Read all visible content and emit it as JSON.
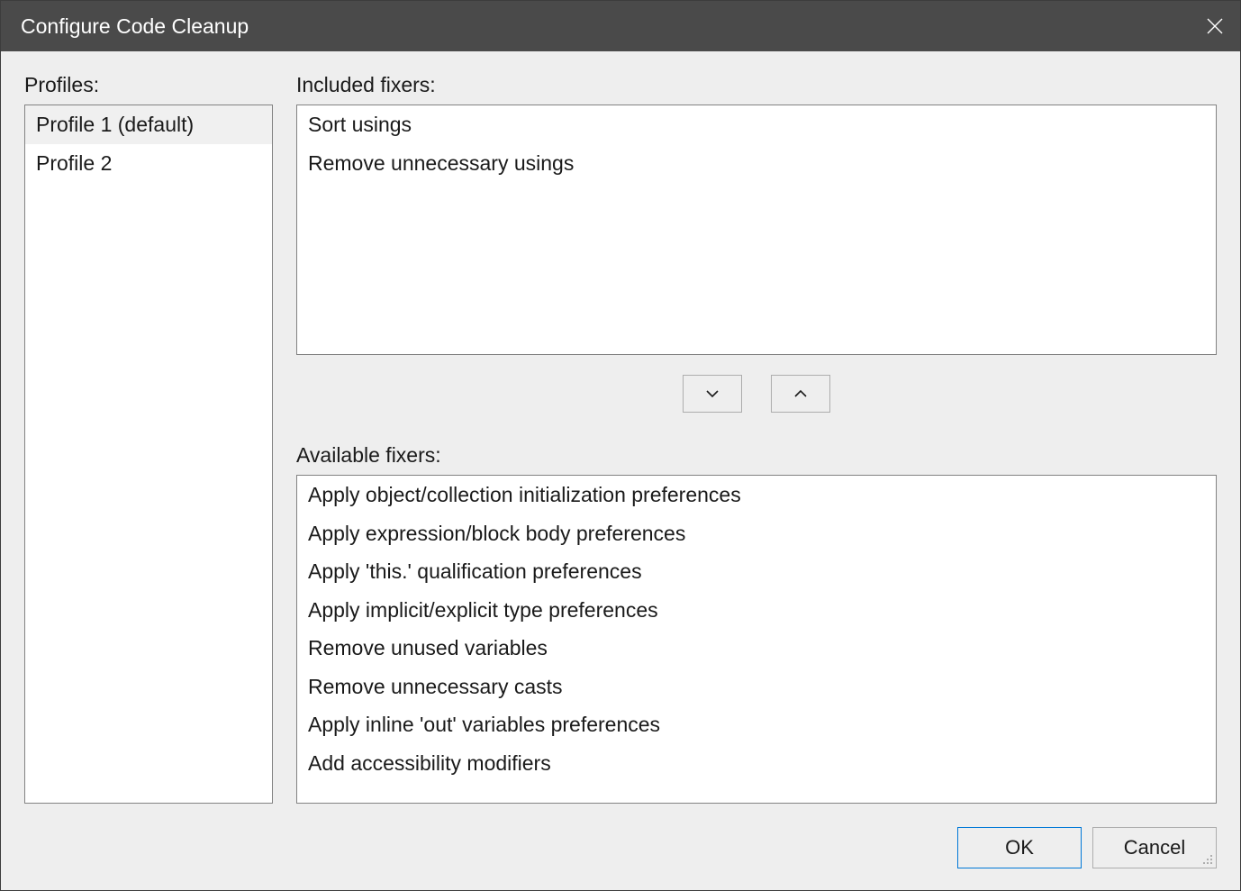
{
  "titlebar": {
    "title": "Configure Code Cleanup"
  },
  "labels": {
    "profiles": "Profiles:",
    "included": "Included fixers:",
    "available": "Available fixers:"
  },
  "profiles": {
    "items": [
      {
        "label": "Profile 1 (default)",
        "selected": true
      },
      {
        "label": "Profile 2",
        "selected": false
      }
    ]
  },
  "included_fixers": [
    "Sort usings",
    "Remove unnecessary usings"
  ],
  "available_fixers": [
    "Apply object/collection initialization preferences",
    "Apply expression/block body preferences",
    "Apply 'this.' qualification preferences",
    "Apply implicit/explicit type preferences",
    "Remove unused variables",
    "Remove unnecessary casts",
    "Apply inline 'out' variables preferences",
    "Add accessibility modifiers"
  ],
  "buttons": {
    "ok": "OK",
    "cancel": "Cancel"
  }
}
